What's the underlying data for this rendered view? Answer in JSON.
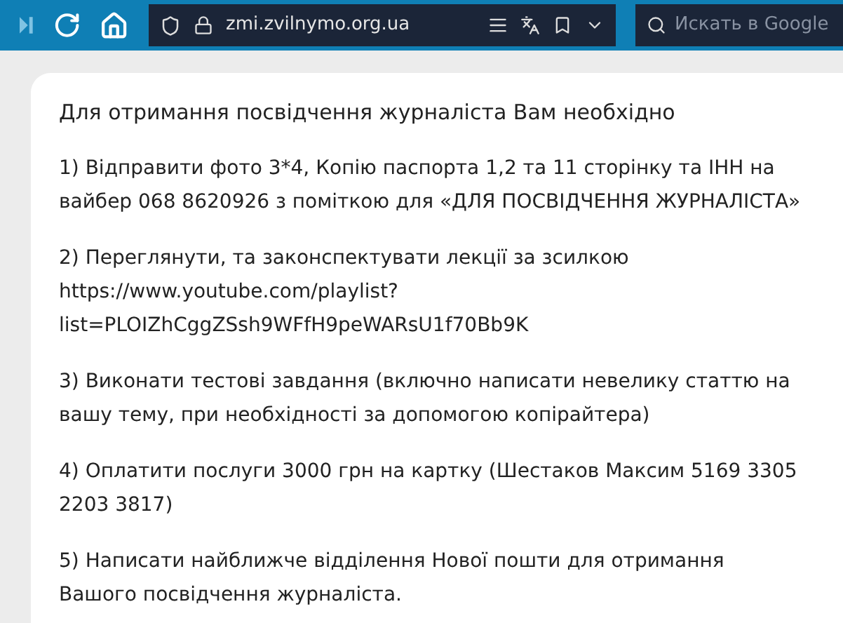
{
  "toolbar": {
    "url": "zmi.zvilnymo.org.ua",
    "search": {
      "placeholder": "Искать в Google"
    }
  },
  "card": {
    "title": "Для отримання посвідчення журналіста Вам необхідно",
    "steps": [
      "1) Відправити фото 3*4, Копію паспорта 1,2 та 11 сторінку та ІНН на вайбер 068 8620926 з поміткою для «ДЛЯ ПОСВІДЧЕННЯ ЖУРНАЛІСТА»",
      "2) Переглянути, та законспектувати лекції за зсилкою https://www.youtube.com/playlist?list=PLOIZhCggZSsh9WFfH9peWARsU1f70Bb9K",
      "3) Виконати тестові завдання (включно написати невелику статтю на вашу тему, при необхідності за допомогою копірайтера)",
      "4) Оплатити послуги 3000 грн на картку (Шестаков Максим 5169 3305 2203 3817)",
      "5) Написати найближче відділення Нової пошти для отримання Вашого посвідчення журналіста."
    ]
  }
}
